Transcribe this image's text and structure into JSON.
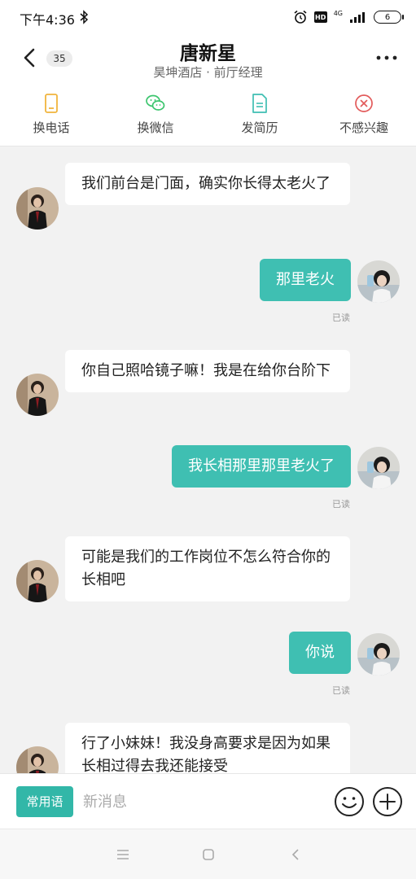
{
  "status_bar": {
    "time": "下午4:36",
    "network": "4G",
    "battery": "6",
    "icons": [
      "bluetooth-icon",
      "alarm-icon",
      "hd-icon",
      "signal-icon",
      "battery-icon"
    ]
  },
  "header": {
    "unread_count": "35",
    "name": "唐新星",
    "subtitle": "昊坤酒店 · 前厅经理"
  },
  "actions": [
    {
      "label": "换电话",
      "icon": "phone-icon",
      "color": "#f0b43c"
    },
    {
      "label": "换微信",
      "icon": "wechat-icon",
      "color": "#3cc56e"
    },
    {
      "label": "发简历",
      "icon": "resume-icon",
      "color": "#3fbfb2"
    },
    {
      "label": "不感兴趣",
      "icon": "not-interested-icon",
      "color": "#e25a5a"
    }
  ],
  "messages": [
    {
      "side": "in",
      "text": "我们前台是门面，确实你长得太老火了"
    },
    {
      "side": "out",
      "text": "那里老火",
      "status": "已读"
    },
    {
      "side": "in",
      "text": "你自己照哈镜子嘛！我是在给你台阶下"
    },
    {
      "side": "out",
      "text": "我长相那里那里老火了",
      "status": "已读"
    },
    {
      "side": "in",
      "text": "可能是我们的工作岗位不怎么符合你的长相吧"
    },
    {
      "side": "out",
      "text": "你说",
      "status": "已读"
    },
    {
      "side": "in",
      "text": "行了小妹妹！我没身高要求是因为如果长相过得去我还能接受"
    }
  ],
  "input_bar": {
    "phrases_label": "常用语",
    "placeholder": "新消息"
  },
  "colors": {
    "accent": "#3fbfb2",
    "phrases_button": "#32b7a8",
    "background": "#f2f2f2"
  }
}
